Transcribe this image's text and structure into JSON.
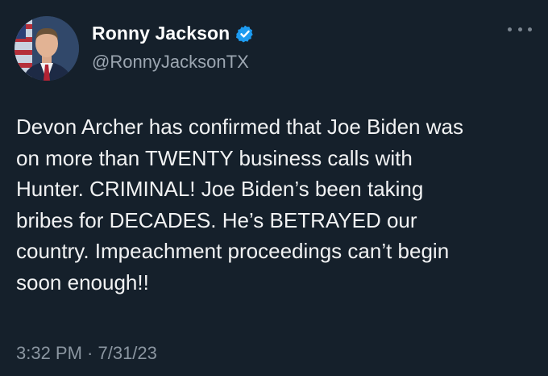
{
  "author": {
    "display_name": "Ronny Jackson",
    "handle": "@RonnyJacksonTX",
    "verified_icon": "verified-badge-icon",
    "verified_color": "#1d9bf0"
  },
  "tweet": {
    "text": "Devon Archer has confirmed that Joe Biden was\non more than TWENTY business calls with\nHunter. CRIMINAL! Joe Biden’s been taking\nbribes for DECADES. He’s BETRAYED our\ncountry. Impeachment proceedings can’t begin\nsoon enough!!",
    "timestamp": "3:32 PM · 7/31/23"
  },
  "colors": {
    "background": "#15202b",
    "text": "#e7e9ea",
    "secondary_text": "#9ca6b1"
  },
  "icons": {
    "more": "more-horizontal-icon"
  }
}
